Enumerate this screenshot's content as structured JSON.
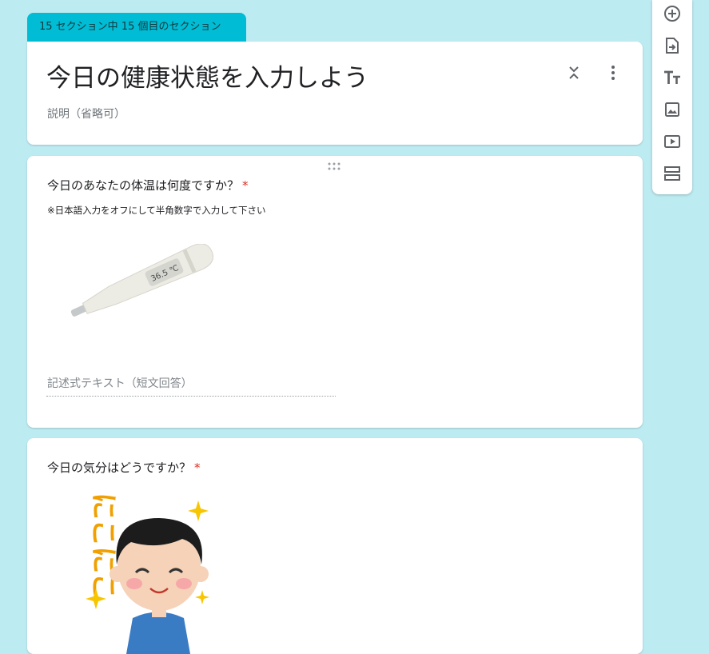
{
  "section": {
    "tab_label": "15 セクション中 15 個目のセクション"
  },
  "form": {
    "title": "今日の健康状態を入力しよう",
    "description_placeholder": "説明（省略可）"
  },
  "questions": [
    {
      "title": "今日のあなたの体温は何度ですか？",
      "required_mark": "*",
      "help_text": "※日本語入力をオフにして半角数字で入力して下さい",
      "image": {
        "icon": "thermometer-illustration",
        "display_text": "36.5 ℃"
      },
      "answer_placeholder": "記述式テキスト（短文回答）"
    },
    {
      "title": "今日の気分はどうですか？",
      "required_mark": "*",
      "image": {
        "icon": "smiling-boy-illustration",
        "display_text": "にこにこ"
      }
    }
  ],
  "toolbar": {
    "items": [
      {
        "icon": "add-question-icon"
      },
      {
        "icon": "import-questions-icon"
      },
      {
        "icon": "add-title-icon"
      },
      {
        "icon": "add-image-icon"
      },
      {
        "icon": "add-video-icon"
      },
      {
        "icon": "add-section-icon"
      }
    ]
  },
  "colors": {
    "background": "#bdebf2",
    "section_tab": "#00bcd4",
    "required": "#d93025"
  }
}
